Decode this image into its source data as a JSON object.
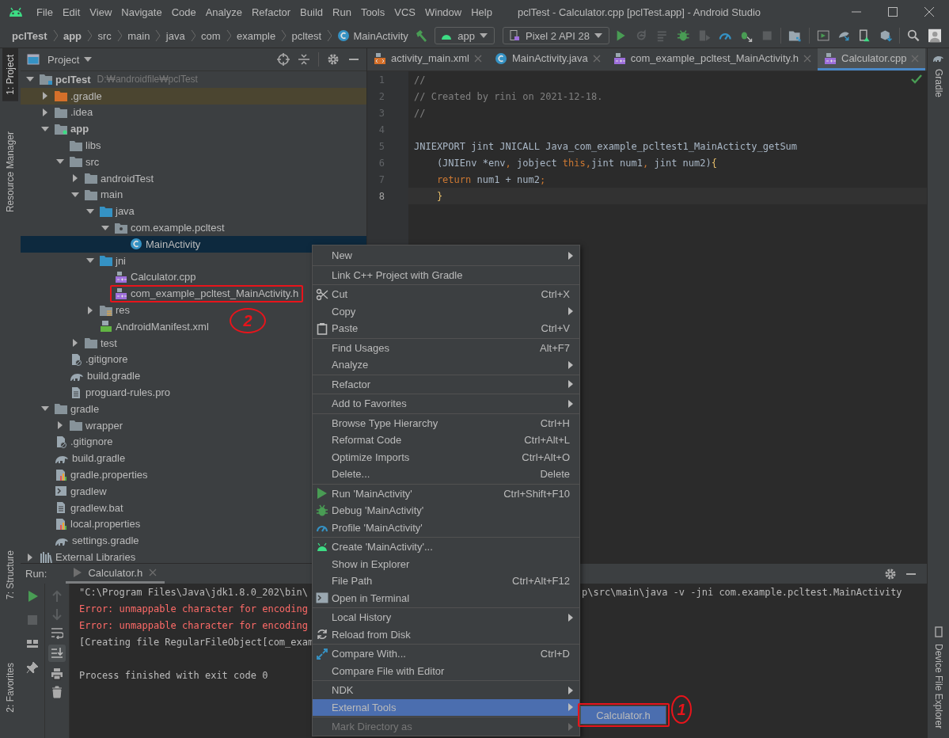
{
  "window": {
    "title": "pclTest - Calculator.cpp [pclTest.app] - Android Studio"
  },
  "menu_bar": [
    "File",
    "Edit",
    "View",
    "Navigate",
    "Code",
    "Analyze",
    "Refactor",
    "Build",
    "Run",
    "Tools",
    "VCS",
    "Window",
    "Help"
  ],
  "breadcrumbs": [
    {
      "label": "pclTest",
      "kind": "project"
    },
    {
      "label": "app",
      "kind": "module"
    },
    {
      "label": "src",
      "kind": "dir"
    },
    {
      "label": "main",
      "kind": "dir"
    },
    {
      "label": "java",
      "kind": "dir"
    },
    {
      "label": "com",
      "kind": "dir"
    },
    {
      "label": "example",
      "kind": "dir"
    },
    {
      "label": "pcltest",
      "kind": "dir"
    },
    {
      "label": "MainActivity",
      "kind": "class"
    }
  ],
  "toolbar": {
    "run_config": "app",
    "device": "Pixel 2 API 28"
  },
  "left_stripe": [
    {
      "label": "1: Project",
      "selected": true
    },
    {
      "label": "Resource Manager",
      "selected": false
    }
  ],
  "left_stripe_bottom": [
    {
      "label": "7: Structure"
    },
    {
      "label": "2: Favorites"
    }
  ],
  "right_stripe": [
    {
      "label": "Gradle"
    },
    {
      "label": "Device File Explorer"
    }
  ],
  "project_panel": {
    "title": "Project",
    "tree": [
      {
        "label": "pclTest",
        "location": "D:₩androidfile₩pclTest",
        "kind": "project",
        "expanded": true,
        "selected": false,
        "children": [
          {
            "label": ".gradle",
            "kind": "excluded-folder",
            "expanded": false,
            "selected": false
          },
          {
            "label": ".idea",
            "kind": "folder",
            "expanded": false,
            "selected": false
          },
          {
            "label": "app",
            "kind": "module",
            "expanded": true,
            "selected": false,
            "children": [
              {
                "label": "libs",
                "kind": "folder",
                "selected": false
              },
              {
                "label": "src",
                "kind": "folder",
                "expanded": true,
                "selected": false,
                "children": [
                  {
                    "label": "androidTest",
                    "kind": "folder",
                    "expanded": false,
                    "selected": false
                  },
                  {
                    "label": "main",
                    "kind": "folder",
                    "expanded": true,
                    "selected": false,
                    "children": [
                      {
                        "label": "java",
                        "kind": "source-folder",
                        "expanded": true,
                        "selected": false,
                        "children": [
                          {
                            "label": "com.example.pcltest",
                            "kind": "package",
                            "expanded": true,
                            "selected": false,
                            "children": [
                              {
                                "label": "MainActivity",
                                "kind": "class",
                                "selected": true
                              }
                            ]
                          }
                        ]
                      },
                      {
                        "label": "jni",
                        "kind": "source-folder",
                        "expanded": true,
                        "selected": false,
                        "children": [
                          {
                            "label": "Calculator.cpp",
                            "kind": "cpp",
                            "selected": false
                          },
                          {
                            "label": "com_example_pcltest_MainActivity.h",
                            "kind": "cpp",
                            "selected": false,
                            "annotation": "2"
                          }
                        ]
                      },
                      {
                        "label": "res",
                        "kind": "res-folder",
                        "expanded": false,
                        "selected": false
                      },
                      {
                        "label": "AndroidManifest.xml",
                        "kind": "manifest",
                        "selected": false
                      }
                    ]
                  },
                  {
                    "label": "test",
                    "kind": "folder",
                    "expanded": false,
                    "selected": false
                  }
                ]
              },
              {
                "label": ".gitignore",
                "kind": "gitignore",
                "selected": false
              },
              {
                "label": "build.gradle",
                "kind": "gradle",
                "selected": false
              },
              {
                "label": "proguard-rules.pro",
                "kind": "text",
                "selected": false
              }
            ]
          },
          {
            "label": "gradle",
            "kind": "folder",
            "expanded": true,
            "selected": false,
            "children": [
              {
                "label": "wrapper",
                "kind": "folder",
                "expanded": false,
                "selected": false
              }
            ]
          },
          {
            "label": ".gitignore",
            "kind": "gitignore",
            "selected": false
          },
          {
            "label": "build.gradle",
            "kind": "gradle",
            "selected": false
          },
          {
            "label": "gradle.properties",
            "kind": "properties",
            "selected": false
          },
          {
            "label": "gradlew",
            "kind": "script",
            "selected": false
          },
          {
            "label": "gradlew.bat",
            "kind": "text",
            "selected": false
          },
          {
            "label": "local.properties",
            "kind": "properties",
            "selected": false
          },
          {
            "label": "settings.gradle",
            "kind": "gradle",
            "selected": false
          }
        ]
      },
      {
        "label": "External Libraries",
        "kind": "libraries",
        "expanded": false,
        "selected": false
      }
    ]
  },
  "editor": {
    "tabs": [
      {
        "label": "activity_main.xml",
        "kind": "xml",
        "selected": false
      },
      {
        "label": "MainActivity.java",
        "kind": "class",
        "selected": false
      },
      {
        "label": "com_example_pcltest_MainActivity.h",
        "kind": "cpp",
        "selected": false
      },
      {
        "label": "Calculator.cpp",
        "kind": "cpp",
        "selected": true
      }
    ],
    "lines": [
      {
        "number": "1",
        "current": false,
        "tokens": [
          {
            "text": "//",
            "kind": "comment"
          }
        ]
      },
      {
        "number": "2",
        "current": false,
        "tokens": [
          {
            "text": "// Created by rini on 2021-12-18.",
            "kind": "comment"
          }
        ]
      },
      {
        "number": "3",
        "current": false,
        "tokens": [
          {
            "text": "//",
            "kind": "comment"
          }
        ]
      },
      {
        "number": "4",
        "current": false
      },
      {
        "number": "5",
        "current": false,
        "tokens": [
          {
            "text": "JNIEXPORT jint JNICALL Java_com_example_pcltest1_MainActicty_getSum",
            "kind": "plain"
          }
        ]
      },
      {
        "number": "6",
        "current": false,
        "tokens": [
          {
            "text": "    (JNIEnv *env",
            "kind": "plain"
          },
          {
            "text": ", ",
            "kind": "keyword"
          },
          {
            "text": "jobject ",
            "kind": "plain"
          },
          {
            "text": "this,",
            "kind": "keyword"
          },
          {
            "text": "jint num1",
            "kind": "plain"
          },
          {
            "text": ", ",
            "kind": "keyword"
          },
          {
            "text": "jint num2)",
            "kind": "plain"
          },
          {
            "text": "{",
            "kind": "brace"
          }
        ]
      },
      {
        "number": "7",
        "current": false,
        "tokens": [
          {
            "text": "    return ",
            "kind": "keyword"
          },
          {
            "text": "num1 + num2",
            "kind": "plain"
          },
          {
            "text": ";",
            "kind": "keyword"
          }
        ]
      },
      {
        "number": "8",
        "current": true,
        "tokens": [
          {
            "text": "    }",
            "kind": "brace"
          }
        ]
      }
    ]
  },
  "run_panel": {
    "label": "Run:",
    "tab": "Calculator.h",
    "lines": [
      {
        "text": "\"C:\\Program Files\\Java\\jdk1.8.0_202\\bin\\",
        "tail": "p\\src\\main\\java -v -jni com.example.pcltest.MainActivity",
        "kind": "command"
      },
      {
        "text": "Error: unmappable character for encoding",
        "kind": "error"
      },
      {
        "text": "Error: unmappable character for encoding",
        "kind": "error"
      },
      {
        "text": "[Creating file RegularFileObject[com_exam",
        "kind": "command"
      },
      {
        "text": "Process finished with exit code 0",
        "kind": "exit"
      }
    ]
  },
  "context_menu": {
    "sections": [
      {
        "items": [
          {
            "label": "New",
            "kind": "plain",
            "submenu": true,
            "selected": false,
            "disabled": false
          }
        ]
      },
      {
        "items": [
          {
            "label": "Link C++ Project with Gradle",
            "kind": "plain",
            "submenu": false,
            "selected": false,
            "disabled": false
          }
        ]
      },
      {
        "items": [
          {
            "label": "Cut",
            "shortcut": "Ctrl+X",
            "kind": "cut",
            "submenu": false,
            "selected": false,
            "disabled": false
          },
          {
            "label": "Copy",
            "kind": "plain",
            "submenu": true,
            "selected": false,
            "disabled": false
          },
          {
            "label": "Paste",
            "shortcut": "Ctrl+V",
            "kind": "paste",
            "submenu": false,
            "selected": false,
            "disabled": false
          }
        ]
      },
      {
        "items": [
          {
            "label": "Find Usages",
            "shortcut": "Alt+F7",
            "kind": "plain",
            "submenu": false,
            "selected": false,
            "disabled": false
          },
          {
            "label": "Analyze",
            "kind": "plain",
            "submenu": true,
            "selected": false,
            "disabled": false
          }
        ]
      },
      {
        "items": [
          {
            "label": "Refactor",
            "kind": "plain",
            "submenu": true,
            "selected": false,
            "disabled": false
          }
        ]
      },
      {
        "items": [
          {
            "label": "Add to Favorites",
            "kind": "plain",
            "submenu": true,
            "selected": false,
            "disabled": false
          }
        ]
      },
      {
        "items": [
          {
            "label": "Browse Type Hierarchy",
            "shortcut": "Ctrl+H",
            "kind": "plain",
            "submenu": false,
            "selected": false,
            "disabled": false
          },
          {
            "label": "Reformat Code",
            "shortcut": "Ctrl+Alt+L",
            "kind": "plain",
            "submenu": false,
            "selected": false,
            "disabled": false
          },
          {
            "label": "Optimize Imports",
            "shortcut": "Ctrl+Alt+O",
            "kind": "plain",
            "submenu": false,
            "selected": false,
            "disabled": false
          },
          {
            "label": "Delete...",
            "shortcut": "Delete",
            "kind": "plain",
            "submenu": false,
            "selected": false,
            "disabled": false
          }
        ]
      },
      {
        "items": [
          {
            "label": "Run 'MainActivity'",
            "shortcut": "Ctrl+Shift+F10",
            "kind": "run",
            "submenu": false,
            "selected": false,
            "disabled": false
          },
          {
            "label": "Debug 'MainActivity'",
            "kind": "debug",
            "submenu": false,
            "selected": false,
            "disabled": false
          },
          {
            "label": "Profile 'MainActivity'",
            "kind": "profile",
            "submenu": false,
            "selected": false,
            "disabled": false
          }
        ]
      },
      {
        "items": [
          {
            "label": "Create 'MainActivity'...",
            "kind": "android",
            "submenu": false,
            "selected": false,
            "disabled": false
          },
          {
            "label": "Show in Explorer",
            "kind": "plain",
            "submenu": false,
            "selected": false,
            "disabled": false
          },
          {
            "label": "File Path",
            "shortcut": "Ctrl+Alt+F12",
            "kind": "plain",
            "submenu": false,
            "selected": false,
            "disabled": false
          },
          {
            "label": "Open in Terminal",
            "kind": "terminal",
            "submenu": false,
            "selected": false,
            "disabled": false
          }
        ]
      },
      {
        "items": [
          {
            "label": "Local History",
            "kind": "plain",
            "submenu": true,
            "selected": false,
            "disabled": false
          },
          {
            "label": "Reload from Disk",
            "kind": "reload",
            "submenu": false,
            "selected": false,
            "disabled": false
          }
        ]
      },
      {
        "items": [
          {
            "label": "Compare With...",
            "shortcut": "Ctrl+D",
            "kind": "compare",
            "submenu": false,
            "selected": false,
            "disabled": false
          },
          {
            "label": "Compare File with Editor",
            "kind": "plain",
            "submenu": false,
            "selected": false,
            "disabled": false
          }
        ]
      },
      {
        "items": [
          {
            "label": "NDK",
            "kind": "plain",
            "submenu": true,
            "selected": false,
            "disabled": false
          },
          {
            "label": "External Tools",
            "kind": "plain",
            "submenu": true,
            "selected": true,
            "disabled": false
          }
        ]
      },
      {
        "items": [
          {
            "label": "Mark Directory as",
            "kind": "plain",
            "submenu": true,
            "selected": false,
            "disabled": true
          }
        ]
      }
    ]
  },
  "submenu": {
    "items": [
      {
        "label": "Calculator.h",
        "selected": true,
        "annotation": "1"
      }
    ]
  }
}
